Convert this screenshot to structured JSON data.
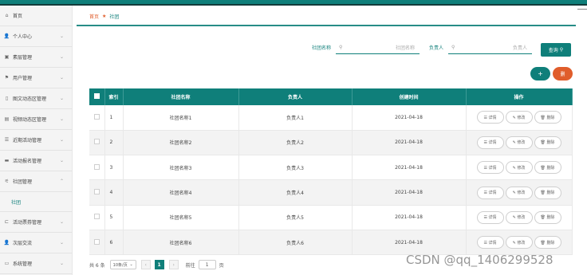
{
  "sidebar": {
    "items": [
      {
        "icon": "home-icon",
        "glyph": "⌂",
        "label": "首页",
        "chevron": ""
      },
      {
        "icon": "user-icon",
        "glyph": "👤",
        "label": "个人中心",
        "chevron": "⌄"
      },
      {
        "icon": "product-icon",
        "glyph": "▣",
        "label": "素层管理",
        "chevron": "⌄"
      },
      {
        "icon": "flag-icon",
        "glyph": "⚑",
        "label": "用户管理",
        "chevron": "⌄"
      },
      {
        "icon": "image-icon",
        "glyph": "▯",
        "label": "图文动态区管理",
        "chevron": "⌄"
      },
      {
        "icon": "video-icon",
        "glyph": "▤",
        "label": "视频动态区管理",
        "chevron": "⌄"
      },
      {
        "icon": "list-icon",
        "glyph": "☰",
        "label": "近期活动管理",
        "chevron": "⌄"
      },
      {
        "icon": "chat-icon",
        "glyph": "▬",
        "label": "活动报名管理",
        "chevron": "⌄"
      },
      {
        "icon": "club-icon",
        "glyph": "⚟",
        "label": "社团管理",
        "chevron": "⌃"
      },
      {
        "icon": "ticket-icon",
        "glyph": "⊏",
        "label": "活动票券管理",
        "chevron": "⌄"
      },
      {
        "icon": "person-icon",
        "glyph": "👤",
        "label": "次层交流",
        "chevron": "⌄"
      },
      {
        "icon": "system-icon",
        "glyph": "▭",
        "label": "系统管理",
        "chevron": "⌄"
      }
    ],
    "sub_item": "社团"
  },
  "breadcrumb": {
    "home": "首页",
    "current": "社团"
  },
  "search": {
    "name_label": "社团名称",
    "name_placeholder": "社团名称",
    "owner_label": "负责人",
    "owner_placeholder": "负责人",
    "query_button": "查询",
    "add_button": "+",
    "delete_button": "删"
  },
  "table": {
    "headers": [
      "索引",
      "社团名称",
      "负责人",
      "创建时间",
      "操作"
    ],
    "rows": [
      {
        "index": "1",
        "name": "社团名称1",
        "owner": "负责人1",
        "date": "2021-04-18"
      },
      {
        "index": "2",
        "name": "社团名称2",
        "owner": "负责人2",
        "date": "2021-04-18"
      },
      {
        "index": "3",
        "name": "社团名称3",
        "owner": "负责人3",
        "date": "2021-04-18"
      },
      {
        "index": "4",
        "name": "社团名称4",
        "owner": "负责人4",
        "date": "2021-04-18"
      },
      {
        "index": "5",
        "name": "社团名称5",
        "owner": "负责人5",
        "date": "2021-04-18"
      },
      {
        "index": "6",
        "name": "社团名称6",
        "owner": "负责人6",
        "date": "2021-04-18"
      }
    ],
    "actions": {
      "detail": "☰ 详情",
      "edit": "✎ 修改",
      "delete": "🗑 删除"
    }
  },
  "pagination": {
    "total": "共 6 条",
    "page_size": "10条/页",
    "prev": "‹",
    "current_page": "1",
    "next": "›",
    "goto_label": "前往",
    "goto_value": "1",
    "page_suffix": "页"
  },
  "watermark": "CSDN @qq_1406299528",
  "colors": {
    "primary": "#0f7f7a",
    "danger": "#e05d2b"
  }
}
